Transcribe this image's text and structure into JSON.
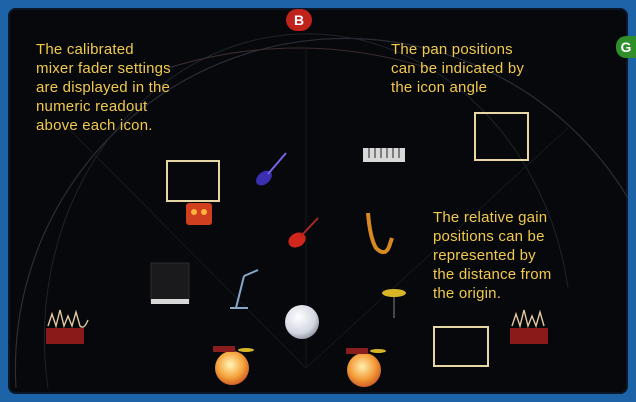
{
  "annotations": {
    "fader_note": [
      "The calibrated",
      "mixer fader settings",
      "are displayed in the",
      "numeric readout",
      "above each icon."
    ],
    "pan_note": [
      "The pan positions",
      "can be indicated by",
      "the icon angle"
    ],
    "gain_note": [
      "The relative gain",
      "positions can be",
      "represented by",
      "the distance from",
      "the origin."
    ]
  },
  "markers": {
    "top": "B",
    "right": "G"
  },
  "colors": {
    "annotation_text": "#f2c94c",
    "frame_blue": "#1d63a8",
    "panel_bg": "#06080c",
    "marker_red": "#c0221c",
    "marker_green": "#2f8f2b",
    "highlight_box": "#e8d7a6"
  },
  "instruments": [
    {
      "name": "synth-keyboard-icon"
    },
    {
      "name": "electric-guitar-icon"
    },
    {
      "name": "amp-icon"
    },
    {
      "name": "red-guitar-icon"
    },
    {
      "name": "saxophone-icon"
    },
    {
      "name": "piano-icon"
    },
    {
      "name": "microphone-icon"
    },
    {
      "name": "cymbal-icon"
    },
    {
      "name": "vocal-ball-icon"
    },
    {
      "name": "left-drum-icon"
    },
    {
      "name": "right-drum-icon"
    },
    {
      "name": "left-waveform-icon"
    },
    {
      "name": "right-waveform-icon"
    }
  ]
}
